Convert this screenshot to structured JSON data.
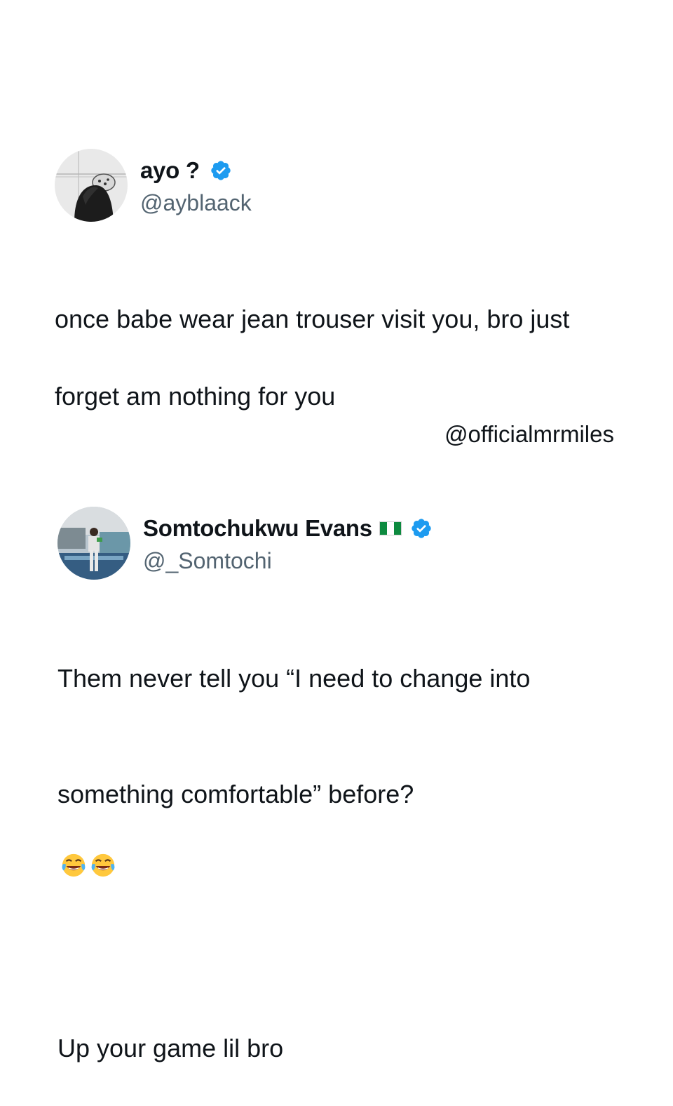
{
  "tweets": [
    {
      "display_name": "ayo ?",
      "handle": "@ayblaack",
      "verified": true,
      "avatar_icon": "profile-photo-avatar",
      "lines": [
        "once babe wear jean trouser visit you, bro just",
        "forget am nothing for you"
      ]
    },
    {
      "display_name": "Somtochukwu Evans",
      "handle": "@_Somtochi",
      "verified": true,
      "flag_icon": "nigeria-flag-icon",
      "avatar_icon": "profile-photo-avatar",
      "lines": [
        "Them never tell you “I need to change into",
        "something comfortable” before?",
        "",
        "Up your game lil bro"
      ],
      "emoji_icon": "face-with-tears-of-joy-icon"
    }
  ],
  "watermark": "@officialmrmiles",
  "colors": {
    "text": "#0f1419",
    "handle": "#536471",
    "verified": "#1d9bf0",
    "flag_green": "#0d8a3f"
  }
}
